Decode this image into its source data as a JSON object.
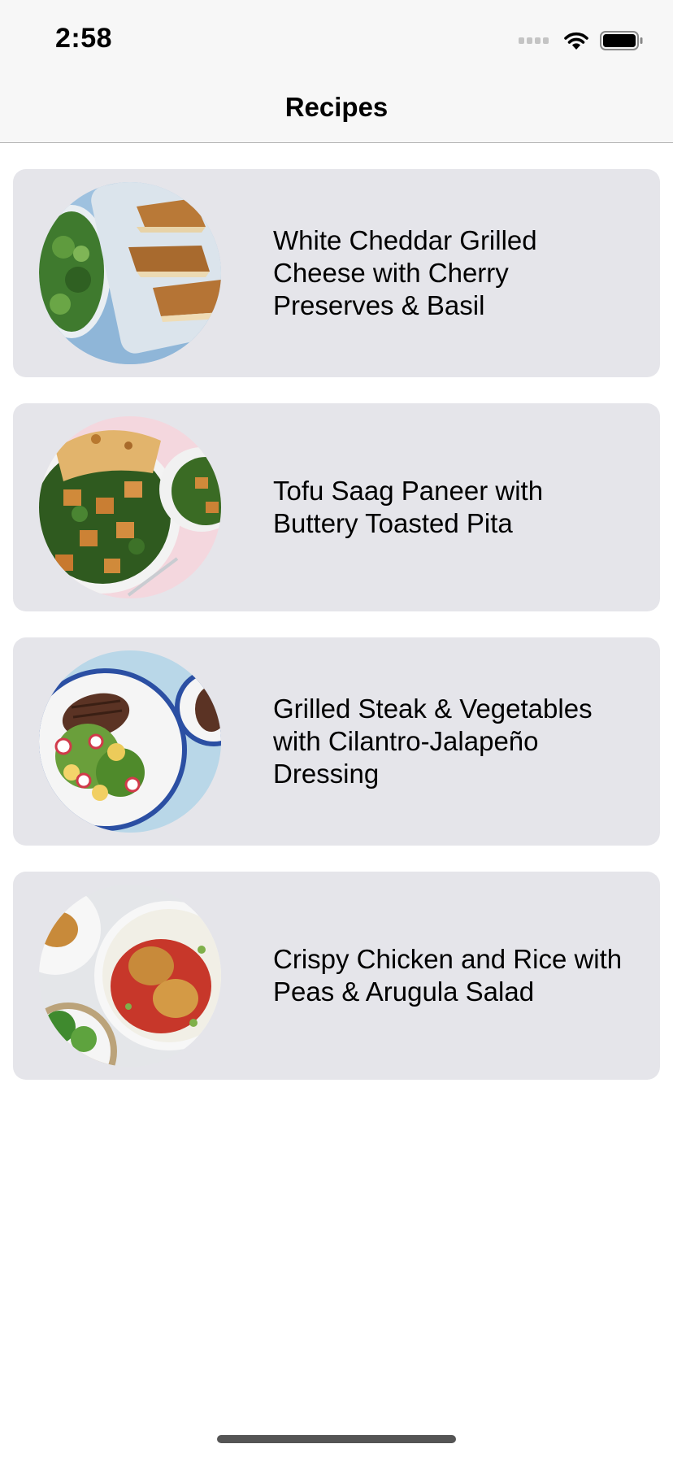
{
  "status_bar": {
    "time": "2:58",
    "icons": [
      "signal-icon",
      "wifi-icon",
      "battery-icon"
    ]
  },
  "nav": {
    "title": "Recipes"
  },
  "recipes": [
    {
      "title": "White Cheddar Grilled Cheese with Cherry Preserves & Basil",
      "image": "grilled-cheese-photo"
    },
    {
      "title": "Tofu Saag Paneer with Buttery Toasted Pita",
      "image": "saag-paneer-photo"
    },
    {
      "title": "Grilled Steak & Vegetables with Cilantro-Jalapeño Dressing",
      "image": "steak-vegetables-photo"
    },
    {
      "title": "Crispy Chicken and Rice with Peas & Arugula Salad",
      "image": "chicken-rice-photo"
    }
  ],
  "colors": {
    "nav_background": "#f7f7f7",
    "card_background": "#e5e5ea",
    "page_background": "#ffffff",
    "separator": "#b2b2b2"
  }
}
